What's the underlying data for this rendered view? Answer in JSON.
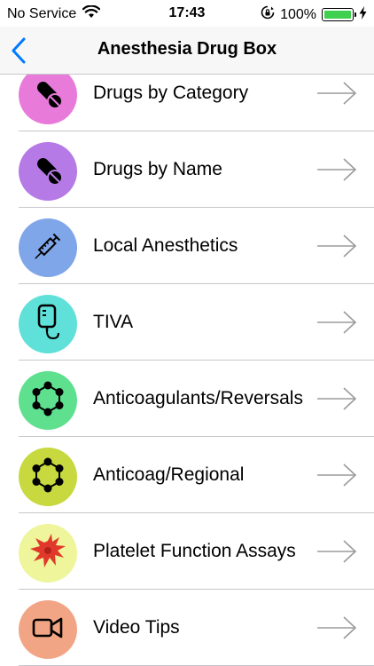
{
  "status_bar": {
    "carrier": "No Service",
    "time": "17:43",
    "battery_percent": "100%",
    "battery_level": 1.0
  },
  "nav": {
    "back_icon": "chevron-left-icon",
    "title": "Anesthesia Drug Box"
  },
  "list": {
    "items": [
      {
        "label": "Drugs by Category",
        "icon": "pill-icon",
        "color": "#e87ad9"
      },
      {
        "label": "Drugs by Name",
        "icon": "pill-icon",
        "color": "#b57ae6"
      },
      {
        "label": "Local Anesthetics",
        "icon": "syringe-icon",
        "color": "#7fa6e8"
      },
      {
        "label": "TIVA",
        "icon": "iv-bag-icon",
        "color": "#5fe0d8"
      },
      {
        "label": "Anticoagulants/Reversals",
        "icon": "molecule-icon",
        "color": "#5ee08f"
      },
      {
        "label": "Anticoag/Regional",
        "icon": "molecule-icon",
        "color": "#c7d93f"
      },
      {
        "label": "Platelet Function Assays",
        "icon": "platelet-icon",
        "color": "#eef59a"
      },
      {
        "label": "Video Tips",
        "icon": "video-camera-icon",
        "color": "#f2a585"
      }
    ]
  },
  "colors": {
    "accent": "#007aff",
    "separator": "#c8c7cc",
    "arrow": "#9b9b9b"
  }
}
